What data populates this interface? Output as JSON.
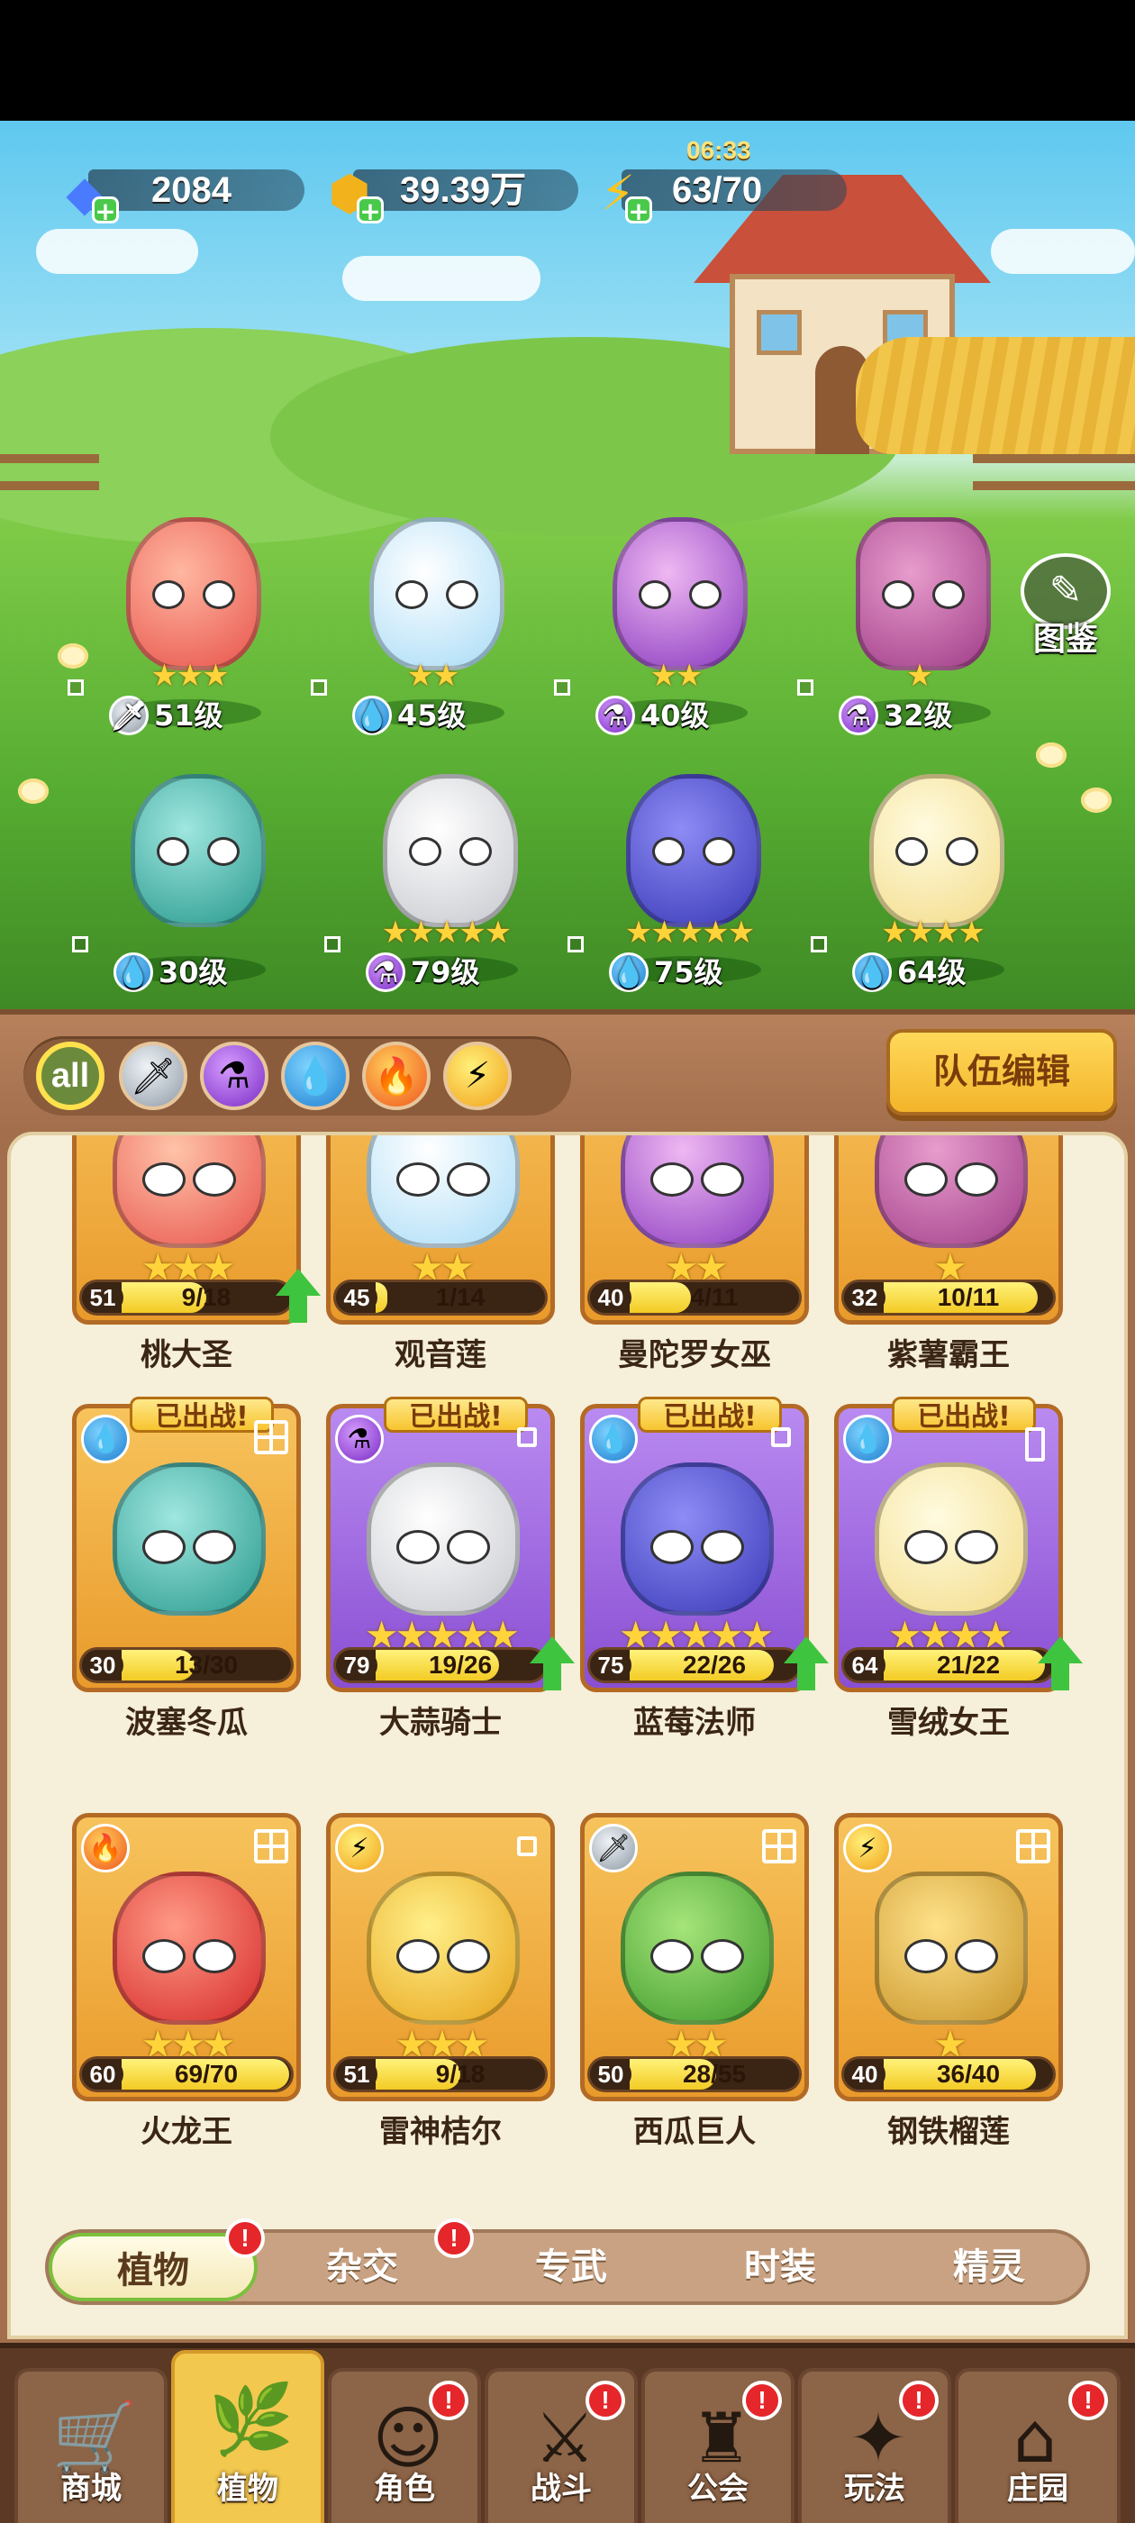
{
  "resources": {
    "gems": "2084",
    "gold": "39.39万",
    "energy": "63/70",
    "energy_timer": "06:33"
  },
  "codex_label": "图鉴",
  "scene_heroes": [
    {
      "stars": "★★★",
      "element": "sword-icon",
      "level": "51级"
    },
    {
      "stars": "★★",
      "element": "water-icon",
      "level": "45级"
    },
    {
      "stars": "★★",
      "element": "potion-icon",
      "level": "40级"
    },
    {
      "stars": "★",
      "element": "potion-icon",
      "level": "32级"
    },
    {
      "stars": "",
      "element": "water-icon",
      "level": "30级"
    },
    {
      "stars": "★★★★★",
      "element": "potion-icon",
      "level": "79级"
    },
    {
      "stars": "★★★★★",
      "element": "water-icon",
      "level": "75级"
    },
    {
      "stars": "★★★★",
      "element": "water-icon",
      "level": "64级"
    }
  ],
  "filters": {
    "all_label": "all",
    "team_edit": "队伍编辑"
  },
  "cards": [
    {
      "name": "桃大圣",
      "level": "51",
      "progress": "9/18",
      "fill": 0.5,
      "stars": "★★★",
      "deployed": false,
      "upgrade": true
    },
    {
      "name": "观音莲",
      "level": "45",
      "progress": "1/14",
      "fill": 0.07,
      "stars": "★★",
      "deployed": false,
      "upgrade": false
    },
    {
      "name": "曼陀罗女巫",
      "level": "40",
      "progress": "4/11",
      "fill": 0.36,
      "stars": "★★",
      "deployed": false,
      "upgrade": false
    },
    {
      "name": "紫薯霸王",
      "level": "32",
      "progress": "10/11",
      "fill": 0.91,
      "stars": "★",
      "deployed": false,
      "upgrade": false
    },
    {
      "name": "波塞冬瓜",
      "level": "30",
      "progress": "13/30",
      "fill": 0.43,
      "stars": "",
      "deployed": true,
      "badge": "已出战!",
      "upgrade": false
    },
    {
      "name": "大蒜骑士",
      "level": "79",
      "progress": "19/26",
      "fill": 0.73,
      "stars": "★★★★★",
      "deployed": true,
      "badge": "已出战!",
      "upgrade": true
    },
    {
      "name": "蓝莓法师",
      "level": "75",
      "progress": "22/26",
      "fill": 0.85,
      "stars": "★★★★★",
      "deployed": true,
      "badge": "已出战!",
      "upgrade": true
    },
    {
      "name": "雪绒女王",
      "level": "64",
      "progress": "21/22",
      "fill": 0.95,
      "stars": "★★★★",
      "deployed": true,
      "badge": "已出战!",
      "upgrade": true
    },
    {
      "name": "火龙王",
      "level": "60",
      "progress": "69/70",
      "fill": 0.99,
      "stars": "★★★",
      "deployed": false,
      "upgrade": false
    },
    {
      "name": "雷神桔尔",
      "level": "51",
      "progress": "9/18",
      "fill": 0.5,
      "stars": "★★★",
      "deployed": false,
      "upgrade": false
    },
    {
      "name": "西瓜巨人",
      "level": "50",
      "progress": "28/55",
      "fill": 0.51,
      "stars": "★★",
      "deployed": false,
      "upgrade": false
    },
    {
      "name": "钢铁榴莲",
      "level": "40",
      "progress": "36/40",
      "fill": 0.9,
      "stars": "★",
      "deployed": false,
      "upgrade": false
    }
  ],
  "subtabs": [
    "植物",
    "杂交",
    "专武",
    "时装",
    "精灵"
  ],
  "bottom_nav": [
    "商城",
    "植物",
    "角色",
    "战斗",
    "公会",
    "玩法",
    "庄园"
  ],
  "colors": {
    "wood": "#a26e4c",
    "panel": "#f6efd9",
    "card_gold": "#f2b54a",
    "card_purple": "#a06ee6",
    "accent_green": "#3fc43f",
    "alert_red": "#e5262a"
  }
}
